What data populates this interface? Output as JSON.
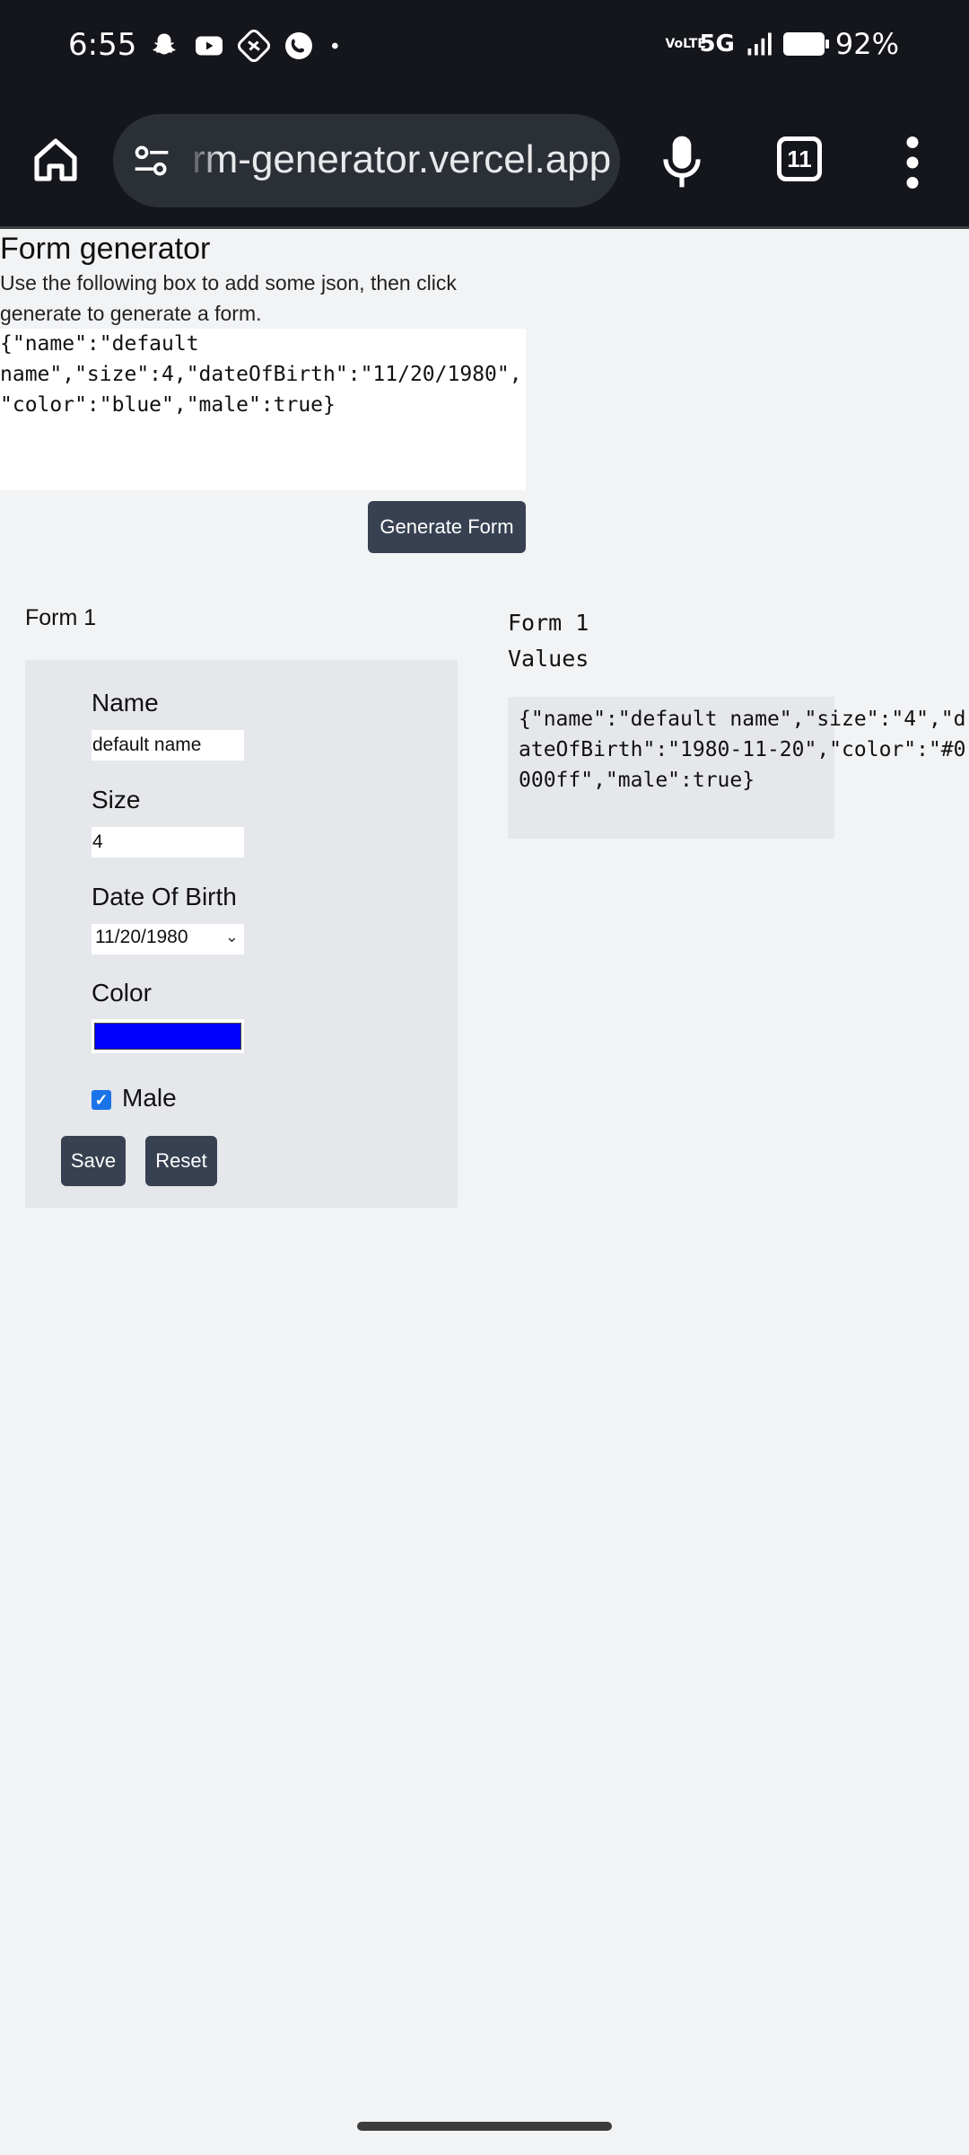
{
  "status_bar": {
    "time": "6:55",
    "notification_icons": [
      "snapchat-icon",
      "youtube-icon",
      "slack-icon",
      "phone-icon",
      "dot-icon"
    ],
    "network_label": "VoLTE",
    "network_type": "5G",
    "battery": "92%"
  },
  "browser": {
    "url": "rm-generator.vercel.app",
    "tab_count": "11"
  },
  "page": {
    "title": "Form generator",
    "description": "Use the following box to add some json, then click generate to generate a form.",
    "json_input": "{\"name\":\"default name\",\"size\":4,\"dateOfBirth\":\"11/20/1980\",\"color\":\"blue\",\"male\":true}",
    "generate_button": "Generate Form"
  },
  "form": {
    "heading": "Form 1",
    "fields": {
      "name_label": "Name",
      "name_value": "default name",
      "size_label": "Size",
      "size_value": "4",
      "dob_label": "Date Of Birth",
      "dob_value": "11/20/1980",
      "color_label": "Color",
      "color_value": "#0000ff",
      "male_label": "Male",
      "male_checked": true
    },
    "save_button": "Save",
    "reset_button": "Reset"
  },
  "values": {
    "heading_line1": "Form 1",
    "heading_line2": "Values",
    "json_output": "{\"name\":\"default name\",\"size\":\"4\",\"dateOfBirth\":\"1980-11-20\",\"color\":\"#0000ff\",\"male\":true}"
  },
  "colors": {
    "button_bg": "#374151",
    "card_bg": "#e5e7eb",
    "page_bg": "#f2f3f5",
    "toolbar_bg": "#14161b"
  }
}
